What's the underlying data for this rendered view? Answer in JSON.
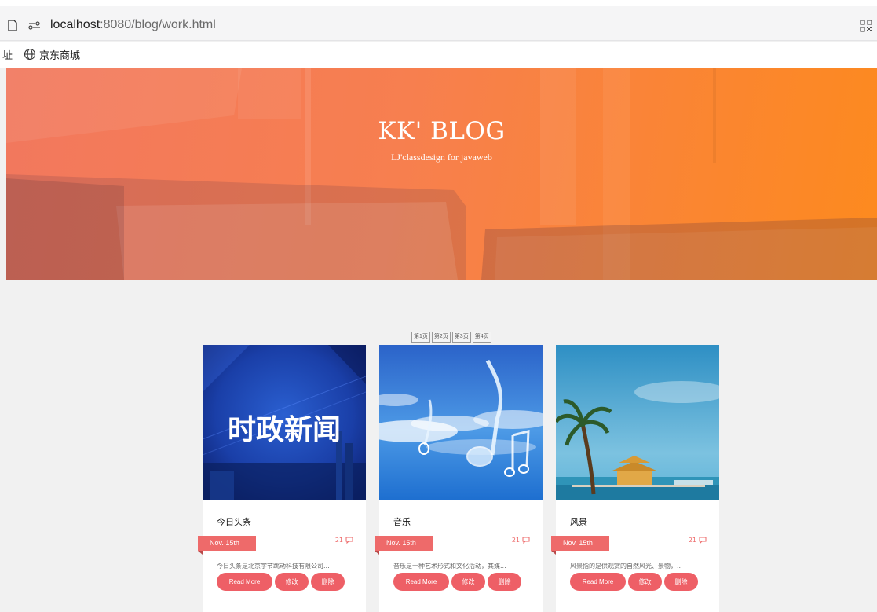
{
  "browser": {
    "url_host": "localhost",
    "url_path": ":8080/blog/work.html",
    "bookmark_cut": "址",
    "bookmark_label": "京东商城"
  },
  "hero": {
    "title": "KK' BLOG",
    "subtitle": "LJ'classdesign for javaweb"
  },
  "pagination": [
    "第1页",
    "第2页",
    "第3页",
    "第4页"
  ],
  "cards": [
    {
      "title": "今日头条",
      "date": "Nov. 15th",
      "comments": "21",
      "excerpt": "今日头条是北京字节跳动科技有限公司...",
      "image": "news-graphic",
      "image_text": "时政新闻",
      "read_more": "Read More",
      "edit": "修改",
      "delete": "删除"
    },
    {
      "title": "音乐",
      "date": "Nov. 15th",
      "comments": "21",
      "excerpt": "音乐是一种艺术形式和文化活动，其媒...",
      "image": "music-notes-sky",
      "read_more": "Read More",
      "edit": "修改",
      "delete": "删除"
    },
    {
      "title": "风景",
      "date": "Nov. 15th",
      "comments": "21",
      "excerpt": "风景指的是供观赏的自然风光、景物，...",
      "image": "palm-beach-pavilion",
      "read_more": "Read More",
      "edit": "修改",
      "delete": "删除"
    }
  ],
  "colors": {
    "accent": "#ee5f66",
    "hero_start": "#f2785e",
    "hero_end": "#fd8a1e"
  }
}
